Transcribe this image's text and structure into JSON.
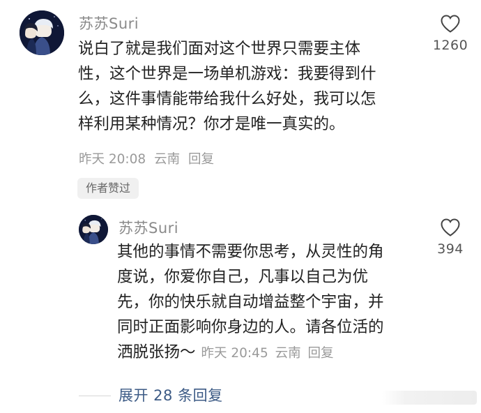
{
  "comment": {
    "username": "苏苏Suri",
    "lines": [
      "说白了就是我们面对这个世界只需要主体",
      "性，这个世界是一场单机游戏：我要得到什",
      "么，这件事情能带给我什么好处，我可以怎",
      "样利用某种情况？你才是唯一真实的。"
    ],
    "time": "昨天 20:08",
    "location": "云南",
    "reply_label": "回复",
    "like_count": "1260",
    "badge": "作者赞过",
    "like_icon": "heart-outline-icon"
  },
  "reply": {
    "username": "苏苏Suri",
    "lines": [
      "其他的事情不需要你思考，从灵性的角",
      "度说，你爱你自己，凡事以自己为优",
      "先，你的快乐就自动增益整个宇宙，并",
      "同时正面影响你身边的人。请各位活的",
      "洒脱张扬～"
    ],
    "time": "昨天 20:45",
    "location": "云南",
    "reply_label": "回复",
    "like_count": "394",
    "like_icon": "heart-outline-icon"
  },
  "expand": {
    "label": "展开 28 条回复"
  },
  "colors": {
    "username": "#8a8a8a",
    "body_text": "#222222",
    "meta": "#9a9a9a",
    "link": "#3c5a85",
    "badge_bg": "#f0f0f0"
  }
}
